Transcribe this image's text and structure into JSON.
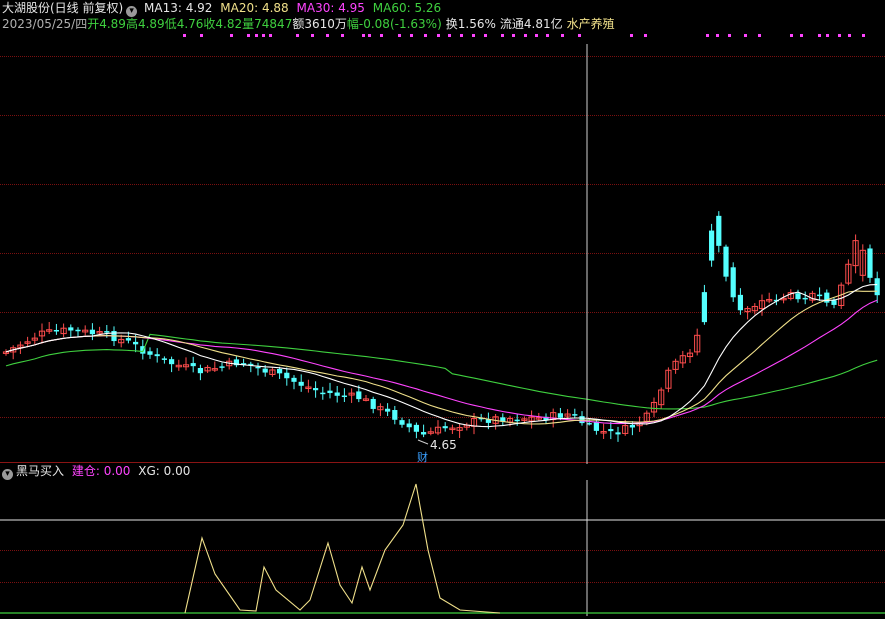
{
  "header": {
    "stock": "大湖股份(日线 前复权)",
    "ma13": "MA13: 4.92",
    "ma20": "MA20: 4.88",
    "ma30": "MA30: 4.95",
    "ma60": "MA60: 5.26",
    "date": "2023/05/25/四",
    "open": "开4.89",
    "high": "高4.89",
    "low": "低4.76",
    "close": "收4.82",
    "volume": "量74847",
    "amount": "额3610万",
    "change": "幅-0.08(-1.63%)",
    "turnover": "换1.56%",
    "float": "流通4.81亿",
    "sector": "水产养殖"
  },
  "annotations": {
    "low_price": "4.65",
    "marker": "财"
  },
  "indicator": {
    "name": "黑马买入",
    "build_label": "建仓: 0.00",
    "xg_label": "XG: 0.00"
  },
  "colors": {
    "up": "#ff4d4d",
    "down": "#54ffff",
    "ma13": "#ffffff",
    "ma20": "#f0e08a",
    "ma30": "#ff44ff",
    "ma60": "#3fd03f"
  }
}
